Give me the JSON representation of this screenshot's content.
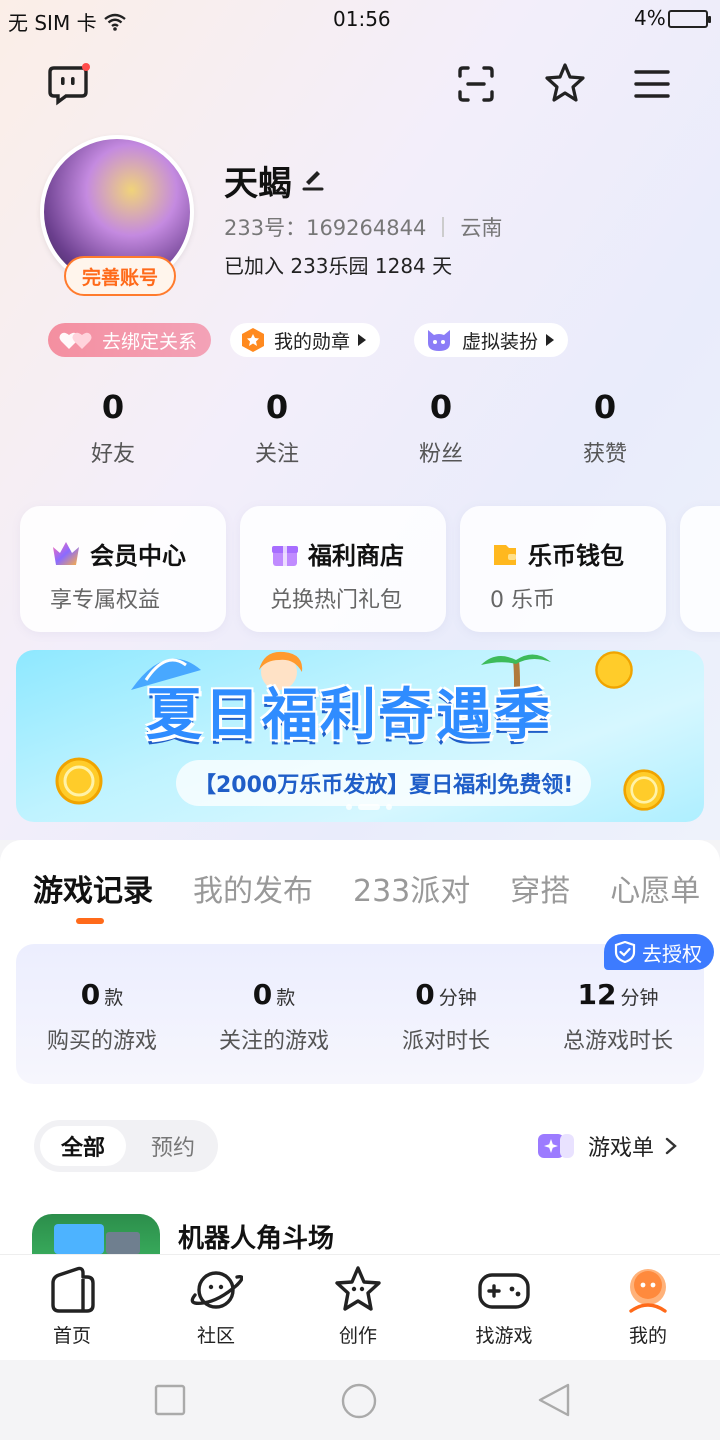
{
  "status_bar": {
    "carrier": "无 SIM 卡",
    "time": "01:56",
    "battery": "4%"
  },
  "profile": {
    "name": "天蝎",
    "uid_label": "233号：169264844",
    "region": "云南",
    "joined": "已加入 233乐园 1284 天",
    "complete_button": "完善账号"
  },
  "chips": [
    {
      "label": "去绑定关系"
    },
    {
      "label": "我的勋章"
    },
    {
      "label": "虚拟装扮"
    }
  ],
  "stats": [
    {
      "value": "0",
      "label": "好友"
    },
    {
      "value": "0",
      "label": "关注"
    },
    {
      "value": "0",
      "label": "粉丝"
    },
    {
      "value": "0",
      "label": "获赞"
    }
  ],
  "cards": [
    {
      "title": "会员中心",
      "sub": "享专属权益"
    },
    {
      "title": "福利商店",
      "sub": "兑换热门礼包"
    },
    {
      "title": "乐币钱包",
      "sub": "0 乐币"
    }
  ],
  "banner": {
    "headline": "夏日福利奇遇季",
    "subline": "【2000万乐币发放】夏日福利免费领!"
  },
  "tabs": [
    "游戏记录",
    "我的发布",
    "233派对",
    "穿搭",
    "心愿单"
  ],
  "records": [
    {
      "value": "0",
      "unit": "款",
      "label": "购买的游戏"
    },
    {
      "value": "0",
      "unit": "款",
      "label": "关注的游戏"
    },
    {
      "value": "0",
      "unit": "分钟",
      "label": "派对时长"
    },
    {
      "value": "12",
      "unit": "分钟",
      "label": "总游戏时长"
    }
  ],
  "auth_badge": "去授权",
  "segment": {
    "all": "全部",
    "reserve": "预约"
  },
  "game_list_link": "游戏单",
  "game": {
    "title": "机器人角斗场"
  },
  "bottom_nav": [
    {
      "label": "首页"
    },
    {
      "label": "社区"
    },
    {
      "label": "创作"
    },
    {
      "label": "找游戏"
    },
    {
      "label": "我的"
    }
  ],
  "colors": {
    "accent": "#ff6a1a",
    "auth_blue": "#3d7bff",
    "pink": "#f48fa0"
  }
}
